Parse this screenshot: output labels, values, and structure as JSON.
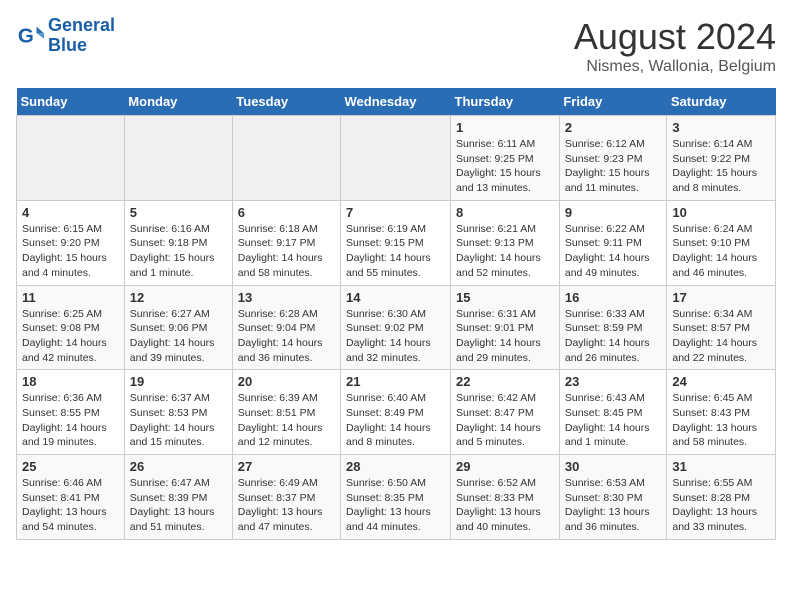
{
  "header": {
    "logo_line1": "General",
    "logo_line2": "Blue",
    "title": "August 2024",
    "subtitle": "Nismes, Wallonia, Belgium"
  },
  "calendar": {
    "weekdays": [
      "Sunday",
      "Monday",
      "Tuesday",
      "Wednesday",
      "Thursday",
      "Friday",
      "Saturday"
    ],
    "weeks": [
      [
        {
          "day": "",
          "info": ""
        },
        {
          "day": "",
          "info": ""
        },
        {
          "day": "",
          "info": ""
        },
        {
          "day": "",
          "info": ""
        },
        {
          "day": "1",
          "info": "Sunrise: 6:11 AM\nSunset: 9:25 PM\nDaylight: 15 hours\nand 13 minutes."
        },
        {
          "day": "2",
          "info": "Sunrise: 6:12 AM\nSunset: 9:23 PM\nDaylight: 15 hours\nand 11 minutes."
        },
        {
          "day": "3",
          "info": "Sunrise: 6:14 AM\nSunset: 9:22 PM\nDaylight: 15 hours\nand 8 minutes."
        }
      ],
      [
        {
          "day": "4",
          "info": "Sunrise: 6:15 AM\nSunset: 9:20 PM\nDaylight: 15 hours\nand 4 minutes."
        },
        {
          "day": "5",
          "info": "Sunrise: 6:16 AM\nSunset: 9:18 PM\nDaylight: 15 hours\nand 1 minute."
        },
        {
          "day": "6",
          "info": "Sunrise: 6:18 AM\nSunset: 9:17 PM\nDaylight: 14 hours\nand 58 minutes."
        },
        {
          "day": "7",
          "info": "Sunrise: 6:19 AM\nSunset: 9:15 PM\nDaylight: 14 hours\nand 55 minutes."
        },
        {
          "day": "8",
          "info": "Sunrise: 6:21 AM\nSunset: 9:13 PM\nDaylight: 14 hours\nand 52 minutes."
        },
        {
          "day": "9",
          "info": "Sunrise: 6:22 AM\nSunset: 9:11 PM\nDaylight: 14 hours\nand 49 minutes."
        },
        {
          "day": "10",
          "info": "Sunrise: 6:24 AM\nSunset: 9:10 PM\nDaylight: 14 hours\nand 46 minutes."
        }
      ],
      [
        {
          "day": "11",
          "info": "Sunrise: 6:25 AM\nSunset: 9:08 PM\nDaylight: 14 hours\nand 42 minutes."
        },
        {
          "day": "12",
          "info": "Sunrise: 6:27 AM\nSunset: 9:06 PM\nDaylight: 14 hours\nand 39 minutes."
        },
        {
          "day": "13",
          "info": "Sunrise: 6:28 AM\nSunset: 9:04 PM\nDaylight: 14 hours\nand 36 minutes."
        },
        {
          "day": "14",
          "info": "Sunrise: 6:30 AM\nSunset: 9:02 PM\nDaylight: 14 hours\nand 32 minutes."
        },
        {
          "day": "15",
          "info": "Sunrise: 6:31 AM\nSunset: 9:01 PM\nDaylight: 14 hours\nand 29 minutes."
        },
        {
          "day": "16",
          "info": "Sunrise: 6:33 AM\nSunset: 8:59 PM\nDaylight: 14 hours\nand 26 minutes."
        },
        {
          "day": "17",
          "info": "Sunrise: 6:34 AM\nSunset: 8:57 PM\nDaylight: 14 hours\nand 22 minutes."
        }
      ],
      [
        {
          "day": "18",
          "info": "Sunrise: 6:36 AM\nSunset: 8:55 PM\nDaylight: 14 hours\nand 19 minutes."
        },
        {
          "day": "19",
          "info": "Sunrise: 6:37 AM\nSunset: 8:53 PM\nDaylight: 14 hours\nand 15 minutes."
        },
        {
          "day": "20",
          "info": "Sunrise: 6:39 AM\nSunset: 8:51 PM\nDaylight: 14 hours\nand 12 minutes."
        },
        {
          "day": "21",
          "info": "Sunrise: 6:40 AM\nSunset: 8:49 PM\nDaylight: 14 hours\nand 8 minutes."
        },
        {
          "day": "22",
          "info": "Sunrise: 6:42 AM\nSunset: 8:47 PM\nDaylight: 14 hours\nand 5 minutes."
        },
        {
          "day": "23",
          "info": "Sunrise: 6:43 AM\nSunset: 8:45 PM\nDaylight: 14 hours\nand 1 minute."
        },
        {
          "day": "24",
          "info": "Sunrise: 6:45 AM\nSunset: 8:43 PM\nDaylight: 13 hours\nand 58 minutes."
        }
      ],
      [
        {
          "day": "25",
          "info": "Sunrise: 6:46 AM\nSunset: 8:41 PM\nDaylight: 13 hours\nand 54 minutes."
        },
        {
          "day": "26",
          "info": "Sunrise: 6:47 AM\nSunset: 8:39 PM\nDaylight: 13 hours\nand 51 minutes."
        },
        {
          "day": "27",
          "info": "Sunrise: 6:49 AM\nSunset: 8:37 PM\nDaylight: 13 hours\nand 47 minutes."
        },
        {
          "day": "28",
          "info": "Sunrise: 6:50 AM\nSunset: 8:35 PM\nDaylight: 13 hours\nand 44 minutes."
        },
        {
          "day": "29",
          "info": "Sunrise: 6:52 AM\nSunset: 8:33 PM\nDaylight: 13 hours\nand 40 minutes."
        },
        {
          "day": "30",
          "info": "Sunrise: 6:53 AM\nSunset: 8:30 PM\nDaylight: 13 hours\nand 36 minutes."
        },
        {
          "day": "31",
          "info": "Sunrise: 6:55 AM\nSunset: 8:28 PM\nDaylight: 13 hours\nand 33 minutes."
        }
      ]
    ]
  }
}
